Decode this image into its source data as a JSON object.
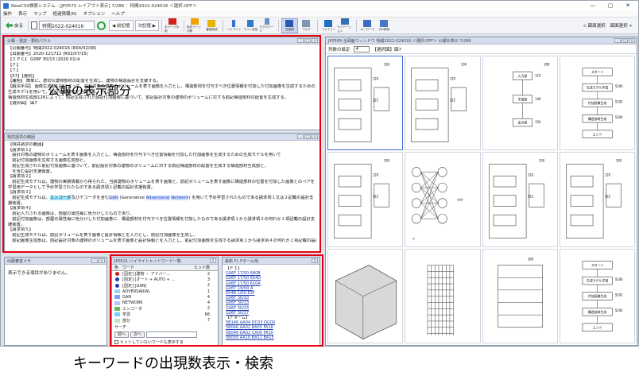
{
  "window": {
    "title": "NewCSS検索システム - [JP0570 レイアウト表示]     7/286 ：特開2022-024016 ＜選択:OFF＞",
    "controls": [
      "—",
      "▢",
      "✕"
    ]
  },
  "menu": [
    "操作",
    "表示",
    "マップ",
    "経過情報(R)",
    "オプション",
    "ヘルプ"
  ],
  "toolbar": {
    "back": "戻る",
    "patent_number": "特開2022-024016",
    "nav_prev": "◀ 前記憶",
    "nav_next": "次記憶 ▶",
    "tools": [
      "全ページ印刷",
      "指定ページ印刷",
      "審査経過",
      "ハイライト",
      "ライト設定",
      "マクロワード",
      "全面図",
      "マルチ",
      "ファミリー",
      "サイテーション",
      "キーワード",
      "KW参照"
    ],
    "prev_drawing": "< 図面選択",
    "next_drawing": "図面選択 >"
  },
  "biblio": {
    "title": "公報・書誌・要約パネル",
    "lines": [
      "【公報番号】特開2022-024016 (R04/02/08)",
      "【出願番号】2020-121712 (R02/07/15)",
      "【ＩＰＣ】 G06F 30/13 (2020.01)※",
      "【Ｆ】",
      "【Ｔ】",
      "",
      "【57】【要約】",
      "【課題】 簡単に、適切な建物部材の配置を生成し、建物の構造設計を支援する。",
      "【解決手段】 画像生成部122によって、設計対象の建物のボリュームを表す画像を入力とし、構造部材を付与すべき位置情報を付加した付加画像を生成するための生成モデルを用いて、前記付加画像を生成する。そして、",
      "構造部材生成部126によって、前記生成された前記付加画像に基づいて、前記設計対象の建物のボリュームに対する前記構造部材の配置を生成する。",
      "【選択図】 図7"
    ]
  },
  "claims": {
    "title": "特許請求の範囲",
    "lines": [
      {
        "text": "【特許請求の範囲】"
      },
      {
        "text": "【請求項１】"
      },
      {
        "text": "　設計対象の建物のボリュームを表す画像を入力とし、構造部材を付与すべき位置情報を付加した付加画像を生成するための生成モデルを用いて"
      },
      {
        "text": "　前記付加画像を生成する画像生成部と、"
      },
      {
        "text": "　前記生成された前記付加画像に基づいて、前記設計対象の建物のボリュームに対する前記構造部材の配置を生成する構造部材生成部と、"
      },
      {
        "text": "　を含む設計支援装置。"
      },
      {
        "text": "【請求項２】"
      },
      {
        "text": "　前記生成モデルは、建物の実績情報から得られた、当該建物のボリュームを表す画像と、前記ボリュームを表す画像に構造部材の位置を付加した画像とのペアを学習用データとして予め学習されたものである請求項１記載の設計支援装置。"
      },
      {
        "text": "【請求項３】"
      },
      {
        "text": "　前記生成モデルは、",
        "hl1": "エンコーダ",
        "mid1": "及びデコーダを含む",
        "hl2": "GAN",
        "mid2": " (Generative ",
        "hl3": "Adversarial",
        "mid3": " ",
        "hl4": "Network",
        "tail": ") を用いて予め学習されたものである請求項１又は２記載の設計支援装置。"
      },
      {
        "text": "【請求項４】"
      },
      {
        "text": "　前記入力される画像は、部屋の属性毎に色分けしたものであり、"
      },
      {
        "text": "　前記付加画像は、部屋の属性毎に色分けした付加画像に、構造部材を付与すべき位置情報を付加したものである請求項１から請求項３の何れか１項記載の設計支援装置。"
      },
      {
        "text": "【請求項５】"
      },
      {
        "text": "　前記生成モデルは、前記ボリュームを表す画像と設計情報とを入力とし、前記付加画像を生成し、"
      },
      {
        "text": "　前記画像生成部は、前記設計対象の建物のボリュームを表す画像と設計情報とを入力とし、前記付加画像を生成する請求項１から請求項４の何れか１項記載の設計支援装置。"
      }
    ]
  },
  "overlay": {
    "publication_label": "公報の表示部分",
    "bottom_caption": "キーワードの出現数表示・検索"
  },
  "chart_data": {
    "type": "table",
    "title": "JP0521 ハイライトヒットワード一覧",
    "columns": [
      "色",
      "ワード",
      "ヒット数"
    ],
    "rows": [
      {
        "color": "#d01818",
        "word": "[固定] [建物 ・ アドバー...",
        "count": 2,
        "dot": true
      },
      {
        "color": "#2038c0",
        "word": "[固定] [オート + AUTO + ...",
        "count": 3,
        "dot": true
      },
      {
        "color": "#2038c0",
        "word": "[固定] [GAN]",
        "count": 2,
        "dot": true
      },
      {
        "color": "#8fd7ff",
        "word": "ADVERSARIAL",
        "count": 1,
        "dot": false
      },
      {
        "color": "#7fa0ff",
        "word": "GAN",
        "count": 4,
        "dot": false
      },
      {
        "color": "#c0c0ff",
        "word": "NETWORK",
        "count": 4,
        "dot": false
      },
      {
        "color": "#60c060",
        "word": "エンコーダ",
        "count": 2,
        "dot": false
      },
      {
        "color": "#70d0ff",
        "word": "学習",
        "count": 68,
        "dot": false
      },
      {
        "color": "#bfe6bf",
        "word": "部分",
        "count": 7,
        "dot": false
      }
    ]
  },
  "keywords": {
    "search_label": "サーチ",
    "prev_button": "前へ",
    "next_button": "次へ",
    "no_hit_toggle": "ヒットしていないワードも表示する"
  },
  "memo": {
    "title": "出願審査メモ",
    "empty_text": "表示できる項目がありません。"
  },
  "fi_panel": {
    "title": "最新 FI, Fターム他",
    "fi_heading": "【ＦＩ】",
    "fi_codes": [
      "G06F 17/50  680B",
      "G06F 17/50  604D",
      "G06F 17/50  610A",
      "G06T 19/00  A",
      "E04B 1/00  E3F",
      "G06F 30/10",
      "G06F 30/13",
      "G06F 30/23",
      "G06F 30/27"
    ],
    "ft_heading": "【Ｆターム】",
    "ft_codes": [
      "5B146 AA04  DC03  DG00",
      "5B046 AA02  BA05  FA18",
      "5B046 DA02  CA05  FA10",
      "5B050 AA10  BA11  BA15"
    ]
  },
  "drawings": {
    "title": "JP0589 全図面ウィンドウ  特開2022-024016 ＜選択:OFF＞  公報外表示 7/286",
    "columns_label": "列数の設定",
    "columns_value": "4",
    "selected_label": "【選択図】図7",
    "figure_labels": [
      "100",
      "120",
      "122",
      "126",
      "130",
      "200",
      "110",
      "140",
      "150",
      "160",
      "y(x)",
      "x",
      "S100",
      "S102",
      "S104",
      "S106",
      "S108",
      "S110",
      "S112",
      "S114",
      "S116",
      "S118"
    ],
    "flow_texts": [
      "入力部",
      "学習部",
      "出力部",
      "スタート",
      "エンド",
      "生成モデル学習",
      "付加画像生成",
      "構造部材生成"
    ]
  }
}
